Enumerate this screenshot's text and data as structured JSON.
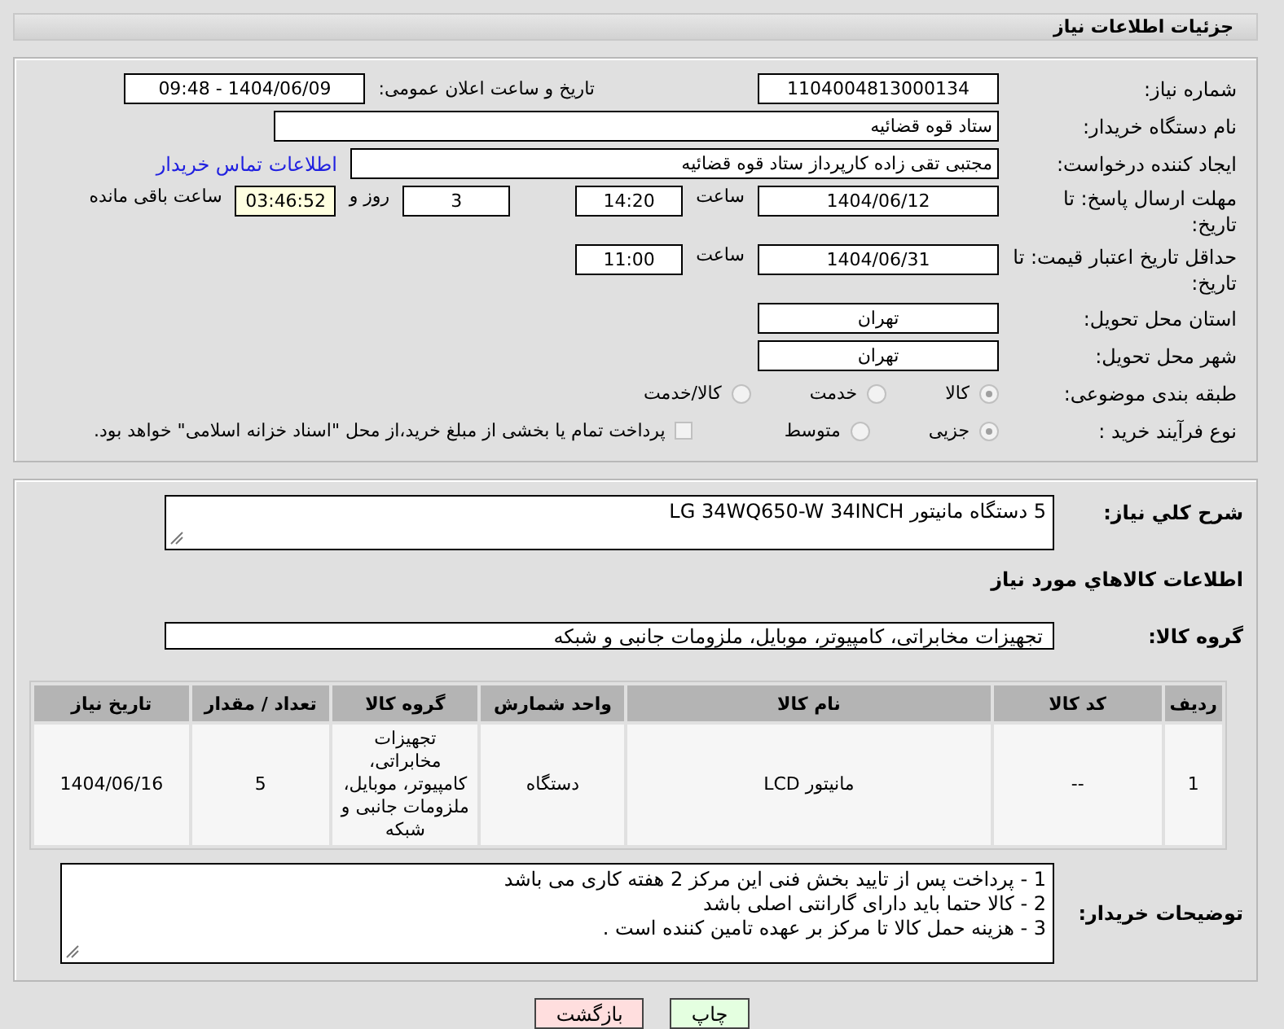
{
  "header": {
    "title": "جزئیات اطلاعات نیاز"
  },
  "form": [
    {
      "label": "شماره نیاز:",
      "items": [
        {
          "kind": "field",
          "text": "1104004813000134"
        },
        {
          "kind": "caption",
          "text": "تاریخ و ساعت اعلان عمومی:"
        },
        {
          "kind": "field",
          "text": "1404/06/09 - 09:48"
        }
      ]
    },
    {
      "label": "نام دستگاه خریدار:",
      "items": [
        {
          "kind": "wide_field",
          "text": "ستاد قوه قضائیه"
        }
      ]
    },
    {
      "label": "ایجاد کننده درخواست:",
      "items": [
        {
          "kind": "name_field",
          "text": "مجتبی تقی زاده کارپرداز ستاد قوه قضائیه"
        },
        {
          "kind": "link",
          "text": "اطلاعات تماس خریدار"
        }
      ]
    },
    {
      "label": "مهلت ارسال پاسخ: تا تاریخ:",
      "items": [
        {
          "kind": "field",
          "text": "1404/06/12"
        },
        {
          "kind": "text",
          "text": "ساعت"
        },
        {
          "kind": "time_field",
          "text": "14:20"
        },
        {
          "kind": "spacer"
        },
        {
          "kind": "time_field",
          "text": "3"
        },
        {
          "kind": "text",
          "text": "روز و"
        },
        {
          "kind": "countdown",
          "text": "03:46:52"
        },
        {
          "kind": "text",
          "text": "ساعت باقی مانده"
        }
      ]
    },
    {
      "label": "حداقل تاریخ اعتبار قیمت: تا تاریخ:",
      "items": [
        {
          "kind": "field",
          "text": "1404/06/31"
        },
        {
          "kind": "text",
          "text": "ساعت"
        },
        {
          "kind": "time_field",
          "text": "11:00"
        }
      ]
    },
    {
      "label": "استان محل تحویل:",
      "items": [
        {
          "kind": "field",
          "text": "تهران"
        }
      ]
    },
    {
      "label": "شهر محل تحویل:",
      "items": [
        {
          "kind": "field",
          "text": "تهران"
        }
      ]
    },
    {
      "label": "طبقه بندی موضوعی:",
      "items": [
        {
          "kind": "radio",
          "text": "کالا",
          "selected": true
        },
        {
          "kind": "radio",
          "text": "خدمت",
          "selected": false
        },
        {
          "kind": "radio",
          "text": "کالا/خدمت",
          "selected": false
        }
      ]
    },
    {
      "label": "نوع فرآیند خرید :",
      "items": [
        {
          "kind": "radio",
          "text": "جزیی",
          "selected": true
        },
        {
          "kind": "radio",
          "text": "متوسط",
          "selected": false
        },
        {
          "kind": "checkbox",
          "text": "پرداخت تمام یا بخشی از مبلغ خرید،از محل \"اسناد خزانه اسلامی\" خواهد بود.",
          "checked": false
        }
      ]
    }
  ],
  "description": {
    "label": "شرح كلي نياز:",
    "value": "5 دستگاه مانیتور LG 34WQ650-W 34INCH"
  },
  "goods_heading": "اطلاعات كالاهاي مورد نياز",
  "goods_group": {
    "label": "گروه كالا:",
    "value": "تجهیزات مخابراتی، کامپیوتر، موبایل، ملزومات جانبی و شبکه"
  },
  "table": {
    "columns": [
      "ردیف",
      "کد کالا",
      "نام کالا",
      "واحد شمارش",
      "گروه کالا",
      "تعداد / مقدار",
      "تاریخ نیاز"
    ],
    "rows": [
      [
        "1",
        "--",
        "مانیتور LCD",
        "دستگاه",
        "تجهیزات مخابراتی، کامپیوتر، موبایل، ملزومات جانبی و شبکه",
        "5",
        "1404/06/16"
      ]
    ]
  },
  "notes": {
    "label": "توضیحات خریدار:",
    "lines": [
      "1 - پرداخت پس از تایید بخش فنی این مرکز 2 هفته  کاری می باشد",
      "2 - کالا حتما باید دارای گارانتی اصلی باشد",
      "3 - هزینه حمل کالا تا مرکز بر عهده تامین کننده است ."
    ]
  },
  "buttons": [
    {
      "kind": "print",
      "label": "چاپ"
    },
    {
      "kind": "back",
      "label": "بازگشت"
    }
  ]
}
